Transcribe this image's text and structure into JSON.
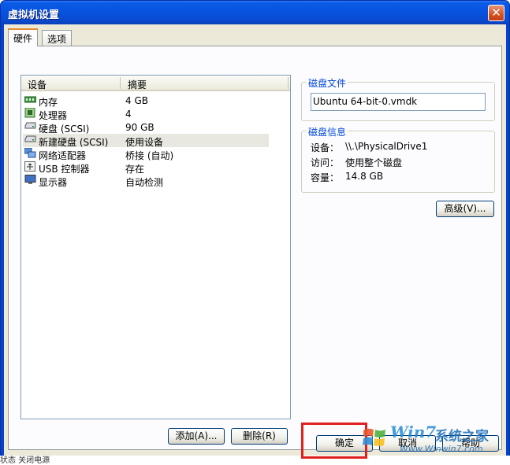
{
  "window": {
    "title": "虚拟机设置",
    "close_glyph": "✕"
  },
  "tabs": [
    {
      "label": "硬件",
      "active": true
    },
    {
      "label": "选项",
      "active": false
    }
  ],
  "device_list": {
    "columns": [
      "设备",
      "摘要"
    ],
    "rows": [
      {
        "icon": "memory-icon",
        "name": "内存",
        "summary": "4 GB",
        "selected": false
      },
      {
        "icon": "processor-icon",
        "name": "处理器",
        "summary": "4",
        "selected": false
      },
      {
        "icon": "hard-disk-icon",
        "name": "硬盘 (SCSI)",
        "summary": "90 GB",
        "selected": false
      },
      {
        "icon": "hard-disk-icon",
        "name": "新建硬盘 (SCSI)",
        "summary": "使用设备",
        "selected": true
      },
      {
        "icon": "network-adapter-icon",
        "name": "网络适配器",
        "summary": "桥接 (自动)",
        "selected": false
      },
      {
        "icon": "usb-icon",
        "name": "USB 控制器",
        "summary": "存在",
        "selected": false
      },
      {
        "icon": "display-icon",
        "name": "显示器",
        "summary": "自动检测",
        "selected": false
      }
    ],
    "add_label": "添加(A)...",
    "remove_label": "删除(R)"
  },
  "disk_file": {
    "group_title": "磁盘文件",
    "value": "Ubuntu 64-bit-0.vmdk"
  },
  "disk_info": {
    "group_title": "磁盘信息",
    "device_label": "设备：",
    "device_value": "\\\\.\\PhysicalDrive1",
    "access_label": "访问：",
    "access_value": "使用整个磁盘",
    "capacity_label": "容量：",
    "capacity_value": "14.8 GB"
  },
  "advanced_label": "高级(V)...",
  "footer": {
    "ok_label": "确定",
    "cancel_label": "取消",
    "help_label": "帮助"
  },
  "watermark": {
    "brand": "Win7",
    "site_cn": "系统之家",
    "url": "Www.Winwin7.com"
  },
  "status_fragment": "状态  关闭电源",
  "colors": {
    "title_bar": "#0753df",
    "group_title": "#0046d5",
    "highlight_border": "#e02020",
    "selected_row": "#e8e8e0"
  }
}
